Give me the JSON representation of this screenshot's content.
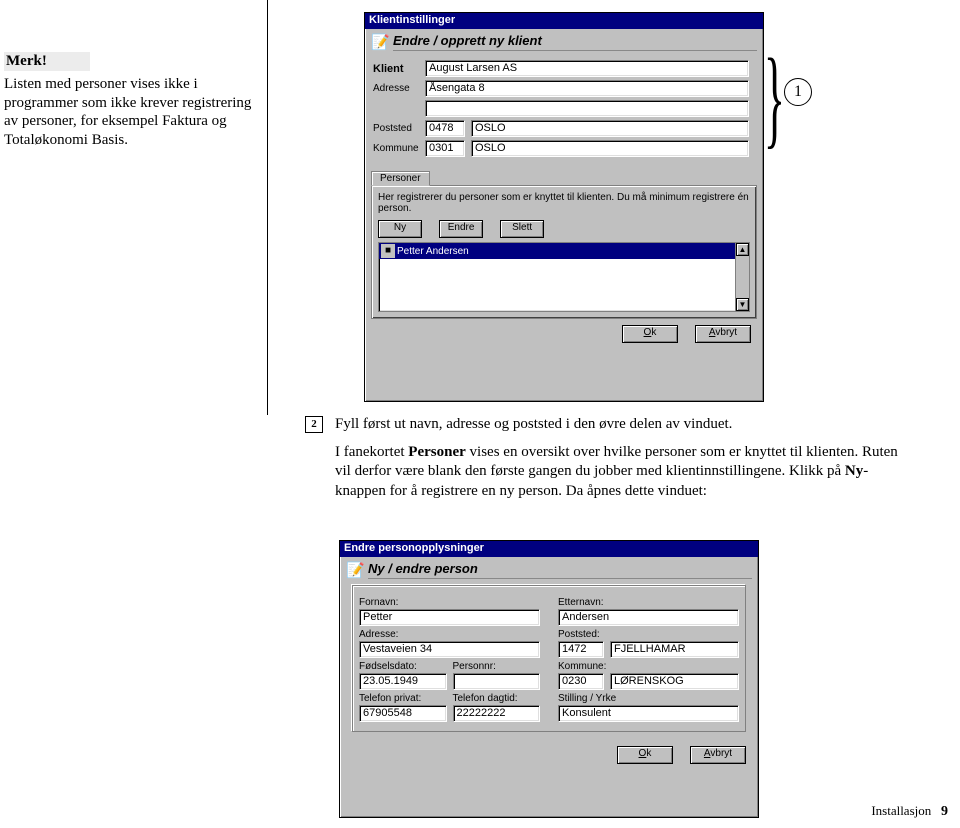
{
  "margin_note": {
    "title": "Merk!",
    "body": "Listen med personer vises ikke i programmer som ikke krever registrering av personer, for eksempel Faktura og Totaløkonomi Basis."
  },
  "callouts": {
    "c1": "1",
    "c2": "2",
    "step_number": "2"
  },
  "paragraph": {
    "p1": "Fyll først ut navn, adresse og poststed i den øvre delen av vinduet.",
    "p2a": "I fanekortet ",
    "p2b": "Personer",
    "p2c": " vises en oversikt over hvilke personer som er knyttet til klienten. Ruten vil derfor være blank den første gangen du jobber med klientinnstillingene. Klikk på ",
    "p2d": "Ny",
    "p2e": "-knappen for å registrere en ny person. Da åpnes dette vinduet:"
  },
  "footer": {
    "label": "Installasjon",
    "page": "9"
  },
  "dialog1": {
    "title": "Klientinstillinger",
    "header": "Endre / opprett ny klient",
    "labels": {
      "klient": "Klient",
      "adresse": "Adresse",
      "poststed": "Poststed",
      "kommune": "Kommune"
    },
    "values": {
      "klient": "August Larsen AS",
      "adresse": "Åsengata 8",
      "post_nr": "0478",
      "post_sted": "OSLO",
      "komm_nr": "0301",
      "komm_navn": "OSLO"
    },
    "tab": "Personer",
    "help_text": "Her registrerer du personer som er knyttet til klienten. Du må minimum registrere én person.",
    "buttons": {
      "ny": "Ny",
      "endre": "Endre",
      "slett": "Slett"
    },
    "list": {
      "row0": "Petter Andersen"
    },
    "ok": "Ok",
    "avbryt": "Avbryt"
  },
  "dialog2": {
    "title": "Endre personopplysninger",
    "header": "Ny / endre person",
    "labels": {
      "fornavn": "Fornavn:",
      "etternavn": "Etternavn:",
      "adresse": "Adresse:",
      "poststed": "Poststed:",
      "fodselsdato": "Fødselsdato:",
      "personnr": "Personnr:",
      "kommune": "Kommune:",
      "tlf_privat": "Telefon privat:",
      "tlf_dagtid": "Telefon dagtid:",
      "stilling": "Stilling / Yrke"
    },
    "values": {
      "fornavn": "Petter",
      "etternavn": "Andersen",
      "adresse": "Vestaveien 34",
      "post_nr": "1472",
      "post_sted": "FJELLHAMAR",
      "fodselsdato": "23.05.1949",
      "personnr": "",
      "komm_nr": "0230",
      "komm_navn": "LØRENSKOG",
      "tlf_privat": "67905548",
      "tlf_dagtid": "22222222",
      "stilling": "Konsulent"
    },
    "ok": "Ok",
    "avbryt": "Avbryt"
  }
}
